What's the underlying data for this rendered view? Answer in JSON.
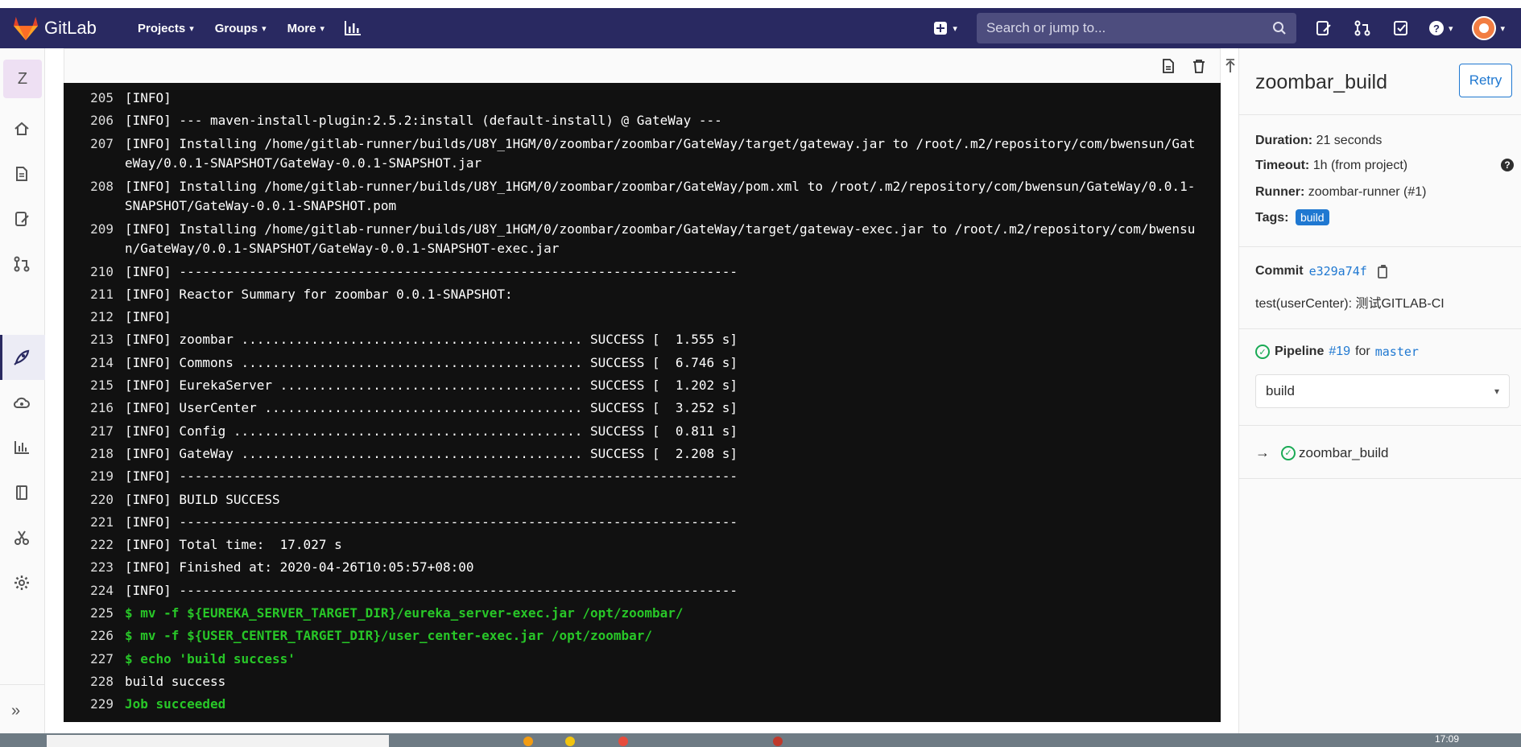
{
  "navbar": {
    "brand": "GitLab",
    "items": [
      "Projects",
      "Groups",
      "More"
    ],
    "search_placeholder": "Search or jump to..."
  },
  "sidebar": {
    "project_letter": "Z",
    "icons": [
      "home-icon",
      "doc-icon",
      "issues-icon",
      "merge-request-icon",
      "rocket-icon",
      "cloud-icon",
      "chart-icon",
      "book-icon",
      "scissors-icon",
      "gear-icon"
    ]
  },
  "log": {
    "lines": [
      {
        "n": "205",
        "t": "[INFO]",
        "style": "normal"
      },
      {
        "n": "206",
        "t": "[INFO] --- maven-install-plugin:2.5.2:install (default-install) @ GateWay ---",
        "style": "normal"
      },
      {
        "n": "207",
        "t": "[INFO] Installing /home/gitlab-runner/builds/U8Y_1HGM/0/zoombar/zoombar/GateWay/target/gateway.jar to /root/.m2/repository/com/bwensun/GateWay/0.0.1-SNAPSHOT/GateWay-0.0.1-SNAPSHOT.jar",
        "style": "normal"
      },
      {
        "n": "208",
        "t": "[INFO] Installing /home/gitlab-runner/builds/U8Y_1HGM/0/zoombar/zoombar/GateWay/pom.xml to /root/.m2/repository/com/bwensun/GateWay/0.0.1-SNAPSHOT/GateWay-0.0.1-SNAPSHOT.pom",
        "style": "normal"
      },
      {
        "n": "209",
        "t": "[INFO] Installing /home/gitlab-runner/builds/U8Y_1HGM/0/zoombar/zoombar/GateWay/target/gateway-exec.jar to /root/.m2/repository/com/bwensun/GateWay/0.0.1-SNAPSHOT/GateWay-0.0.1-SNAPSHOT-exec.jar",
        "style": "normal"
      },
      {
        "n": "210",
        "t": "[INFO] ------------------------------------------------------------------------",
        "style": "normal"
      },
      {
        "n": "211",
        "t": "[INFO] Reactor Summary for zoombar 0.0.1-SNAPSHOT:",
        "style": "normal"
      },
      {
        "n": "212",
        "t": "[INFO]",
        "style": "normal"
      },
      {
        "n": "213",
        "t": "[INFO] zoombar ............................................ SUCCESS [  1.555 s]",
        "style": "normal"
      },
      {
        "n": "214",
        "t": "[INFO] Commons ............................................ SUCCESS [  6.746 s]",
        "style": "normal"
      },
      {
        "n": "215",
        "t": "[INFO] EurekaServer ....................................... SUCCESS [  1.202 s]",
        "style": "normal"
      },
      {
        "n": "216",
        "t": "[INFO] UserCenter ......................................... SUCCESS [  3.252 s]",
        "style": "normal"
      },
      {
        "n": "217",
        "t": "[INFO] Config ............................................. SUCCESS [  0.811 s]",
        "style": "normal"
      },
      {
        "n": "218",
        "t": "[INFO] GateWay ............................................ SUCCESS [  2.208 s]",
        "style": "normal"
      },
      {
        "n": "219",
        "t": "[INFO] ------------------------------------------------------------------------",
        "style": "normal"
      },
      {
        "n": "220",
        "t": "[INFO] BUILD SUCCESS",
        "style": "normal"
      },
      {
        "n": "221",
        "t": "[INFO] ------------------------------------------------------------------------",
        "style": "normal"
      },
      {
        "n": "222",
        "t": "[INFO] Total time:  17.027 s",
        "style": "normal"
      },
      {
        "n": "223",
        "t": "[INFO] Finished at: 2020-04-26T10:05:57+08:00",
        "style": "normal"
      },
      {
        "n": "224",
        "t": "[INFO] ------------------------------------------------------------------------",
        "style": "normal"
      },
      {
        "n": "225",
        "t": "$ mv -f ${EUREKA_SERVER_TARGET_DIR}/eureka_server-exec.jar /opt/zoombar/",
        "style": "green"
      },
      {
        "n": "226",
        "t": "$ mv -f ${USER_CENTER_TARGET_DIR}/user_center-exec.jar /opt/zoombar/",
        "style": "green"
      },
      {
        "n": "227",
        "t": "$ echo 'build success'",
        "style": "green"
      },
      {
        "n": "228",
        "t": "build success",
        "style": "normal"
      },
      {
        "n": "229",
        "t": "Job succeeded",
        "style": "green"
      }
    ]
  },
  "job": {
    "title": "zoombar_build",
    "retry_label": "Retry",
    "duration_label": "Duration:",
    "duration_value": "21 seconds",
    "timeout_label": "Timeout:",
    "timeout_value": "1h (from project)",
    "runner_label": "Runner:",
    "runner_value": "zoombar-runner (#1)",
    "tags_label": "Tags:",
    "tag": "build",
    "commit_label": "Commit",
    "commit_sha": "e329a74f",
    "commit_message": "test(userCenter): 测试GITLAB-CI",
    "pipeline_label": "Pipeline",
    "pipeline_id": "#19",
    "pipeline_for": "for",
    "pipeline_ref": "master",
    "stage": "build",
    "job_link": "zoombar_build"
  },
  "taskbar": {
    "time": "17:09"
  },
  "colors": {
    "navbar": "#292961",
    "accent": "#1f78d1",
    "success": "#1aaa55",
    "log_green": "#28c728"
  }
}
